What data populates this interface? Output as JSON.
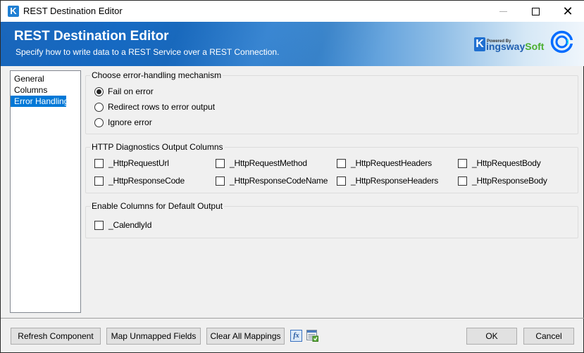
{
  "window": {
    "title": "REST Destination Editor",
    "app_icon_letter": "K",
    "controls": {
      "minimize": "minimize",
      "maximize": "maximize",
      "close": "✕"
    }
  },
  "banner": {
    "title": "REST Destination Editor",
    "subtitle": "Specify how to write data to a REST Service over a REST Connection.",
    "vendor_logo": {
      "powered_by": "Powered By",
      "k_letter": "K",
      "name_main": "ingsway",
      "name_accent": "Soft"
    },
    "connector_logo": "calendly-logo"
  },
  "sidebar": {
    "items": [
      {
        "label": "General",
        "selected": false
      },
      {
        "label": "Columns",
        "selected": false
      },
      {
        "label": "Error Handling",
        "selected": true
      }
    ]
  },
  "error_handling": {
    "label": "Choose error-handling mechanism",
    "options": [
      {
        "label": "Fail on error",
        "checked": true
      },
      {
        "label": "Redirect rows to error output",
        "checked": false
      },
      {
        "label": "Ignore error",
        "checked": false
      }
    ]
  },
  "http_diagnostics": {
    "label": "HTTP Diagnostics Output Columns",
    "columns": [
      {
        "label": "_HttpRequestUrl",
        "checked": false
      },
      {
        "label": "_HttpRequestMethod",
        "checked": false
      },
      {
        "label": "_HttpRequestHeaders",
        "checked": false
      },
      {
        "label": "_HttpRequestBody",
        "checked": false
      },
      {
        "label": "_HttpResponseCode",
        "checked": false
      },
      {
        "label": "_HttpResponseCodeName",
        "checked": false
      },
      {
        "label": "_HttpResponseHeaders",
        "checked": false
      },
      {
        "label": "_HttpResponseBody",
        "checked": false
      }
    ]
  },
  "default_output": {
    "label": "Enable Columns for Default Output",
    "columns": [
      {
        "label": "_CalendlyId",
        "checked": false
      }
    ]
  },
  "footer": {
    "refresh_label": "Refresh Component",
    "map_label": "Map Unmapped Fields",
    "clear_label": "Clear All Mappings",
    "fx_icon_text": "fx",
    "ok_label": "OK",
    "cancel_label": "Cancel"
  },
  "colors": {
    "selection": "#0078d7",
    "banner_dark": "#0e5fb8",
    "kingsway_blue": "#1f5fb0",
    "kingsway_green": "#4caf30",
    "calendly_blue": "#006bff"
  }
}
